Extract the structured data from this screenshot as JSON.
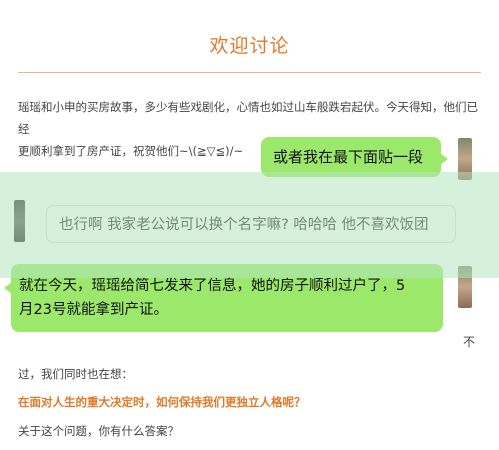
{
  "header": {
    "title": "欢迎讨论"
  },
  "article": {
    "intro_line1": "瑶瑶和小申的买房故事，多少有些戏剧化，心情也如过山车般跌宕起伏。今天得知，他们已经",
    "intro_line2": "更顺利拿到了房产证，祝贺他们~\\(≧▽≦)/~"
  },
  "chat": {
    "bubble_right_1": "或者我在最下面贴一段",
    "bubble_left_white": "也行啊 我家老公说可以换个名字嘛? 哈哈哈 他不喜欢饭团",
    "bubble_green_line1": "就在今天，瑶瑶给简七发来了信息，她的房子顺利过户了，5",
    "bubble_green_line2": "月23号就能拿到产证。",
    "side_char": "不"
  },
  "questions": {
    "lead": "过，我们同时也在想：",
    "main": "在面对人生的重大决定时，如何保持我们更独立人格呢？",
    "ask": "关于这个问题，你有什么答案？"
  },
  "colors": {
    "accent": "#e07a2a",
    "bubble_green": "#9be86b"
  }
}
